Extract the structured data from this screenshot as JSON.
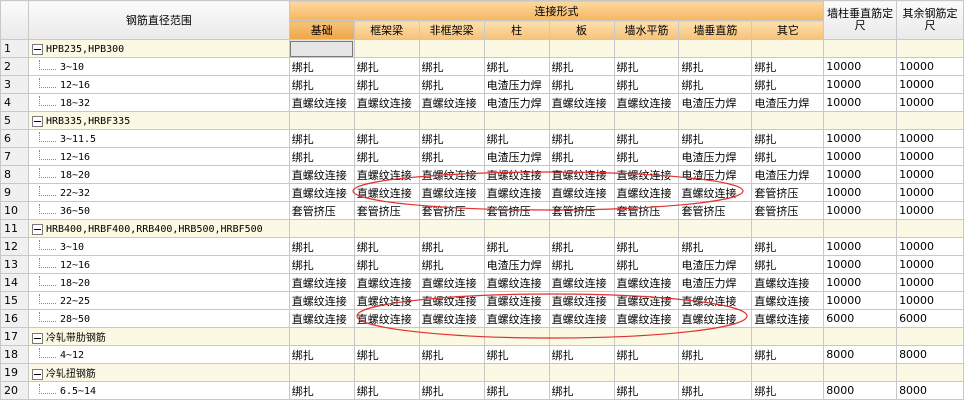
{
  "header": {
    "col_name": "钢筋直径范围",
    "group": "连接形式",
    "sub": [
      "基础",
      "框架梁",
      "非框架梁",
      "柱",
      "板",
      "墙水平筋",
      "墙垂直筋",
      "其它"
    ],
    "wall_col": "墙柱垂直筋定尺",
    "other_col": "其余钢筋定尺"
  },
  "rows": [
    {
      "n": "1",
      "group": true,
      "name": "HPB235,HPB300",
      "cells": [
        "",
        "",
        "",
        "",
        "",
        "",
        "",
        ""
      ],
      "a": "",
      "b": ""
    },
    {
      "n": "2",
      "name": "3~10",
      "cells": [
        "绑扎",
        "绑扎",
        "绑扎",
        "绑扎",
        "绑扎",
        "绑扎",
        "绑扎",
        "绑扎"
      ],
      "a": "10000",
      "b": "10000"
    },
    {
      "n": "3",
      "name": "12~16",
      "cells": [
        "绑扎",
        "绑扎",
        "绑扎",
        "电渣压力焊",
        "绑扎",
        "绑扎",
        "绑扎",
        "绑扎"
      ],
      "a": "10000",
      "b": "10000"
    },
    {
      "n": "4",
      "name": "18~32",
      "cells": [
        "直螺纹连接",
        "直螺纹连接",
        "直螺纹连接",
        "电渣压力焊",
        "直螺纹连接",
        "直螺纹连接",
        "电渣压力焊",
        "电渣压力焊"
      ],
      "a": "10000",
      "b": "10000"
    },
    {
      "n": "5",
      "group": true,
      "name": "HRB335,HRBF335",
      "cells": [
        "",
        "",
        "",
        "",
        "",
        "",
        "",
        ""
      ],
      "a": "",
      "b": ""
    },
    {
      "n": "6",
      "name": "3~11.5",
      "cells": [
        "绑扎",
        "绑扎",
        "绑扎",
        "绑扎",
        "绑扎",
        "绑扎",
        "绑扎",
        "绑扎"
      ],
      "a": "10000",
      "b": "10000"
    },
    {
      "n": "7",
      "name": "12~16",
      "cells": [
        "绑扎",
        "绑扎",
        "绑扎",
        "电渣压力焊",
        "绑扎",
        "绑扎",
        "电渣压力焊",
        "绑扎"
      ],
      "a": "10000",
      "b": "10000"
    },
    {
      "n": "8",
      "name": "18~20",
      "cells": [
        "直螺纹连接",
        "直螺纹连接",
        "直螺纹连接",
        "直螺纹连接",
        "直螺纹连接",
        "直螺纹连接",
        "电渣压力焊",
        "电渣压力焊"
      ],
      "a": "10000",
      "b": "10000"
    },
    {
      "n": "9",
      "name": "22~32",
      "cells": [
        "直螺纹连接",
        "直螺纹连接",
        "直螺纹连接",
        "直螺纹连接",
        "直螺纹连接",
        "直螺纹连接",
        "直螺纹连接",
        "套管挤压"
      ],
      "a": "10000",
      "b": "10000"
    },
    {
      "n": "10",
      "name": "36~50",
      "cells": [
        "套管挤压",
        "套管挤压",
        "套管挤压",
        "套管挤压",
        "套管挤压",
        "套管挤压",
        "套管挤压",
        "套管挤压"
      ],
      "a": "10000",
      "b": "10000"
    },
    {
      "n": "11",
      "group": true,
      "name": "HRB400,HRBF400,RRB400,HRB500,HRBF500",
      "cells": [
        "",
        "",
        "",
        "",
        "",
        "",
        "",
        ""
      ],
      "a": "",
      "b": ""
    },
    {
      "n": "12",
      "name": "3~10",
      "cells": [
        "绑扎",
        "绑扎",
        "绑扎",
        "绑扎",
        "绑扎",
        "绑扎",
        "绑扎",
        "绑扎"
      ],
      "a": "10000",
      "b": "10000"
    },
    {
      "n": "13",
      "name": "12~16",
      "cells": [
        "绑扎",
        "绑扎",
        "绑扎",
        "电渣压力焊",
        "绑扎",
        "绑扎",
        "电渣压力焊",
        "绑扎"
      ],
      "a": "10000",
      "b": "10000"
    },
    {
      "n": "14",
      "name": "18~20",
      "cells": [
        "直螺纹连接",
        "直螺纹连接",
        "直螺纹连接",
        "直螺纹连接",
        "直螺纹连接",
        "直螺纹连接",
        "电渣压力焊",
        "直螺纹连接"
      ],
      "a": "10000",
      "b": "10000"
    },
    {
      "n": "15",
      "name": "22~25",
      "cells": [
        "直螺纹连接",
        "直螺纹连接",
        "直螺纹连接",
        "直螺纹连接",
        "直螺纹连接",
        "直螺纹连接",
        "直螺纹连接",
        "直螺纹连接"
      ],
      "a": "10000",
      "b": "10000"
    },
    {
      "n": "16",
      "name": "28~50",
      "cells": [
        "直螺纹连接",
        "直螺纹连接",
        "直螺纹连接",
        "直螺纹连接",
        "直螺纹连接",
        "直螺纹连接",
        "直螺纹连接",
        "直螺纹连接"
      ],
      "a": "6000",
      "b": "6000"
    },
    {
      "n": "17",
      "group": true,
      "name": "冷轧带肋钢筋",
      "cells": [
        "",
        "",
        "",
        "",
        "",
        "",
        "",
        ""
      ],
      "a": "",
      "b": ""
    },
    {
      "n": "18",
      "name": "4~12",
      "cells": [
        "绑扎",
        "绑扎",
        "绑扎",
        "绑扎",
        "绑扎",
        "绑扎",
        "绑扎",
        "绑扎"
      ],
      "a": "8000",
      "b": "8000"
    },
    {
      "n": "19",
      "group": true,
      "name": "冷轧扭钢筋",
      "cells": [
        "",
        "",
        "",
        "",
        "",
        "",
        "",
        ""
      ],
      "a": "",
      "b": ""
    },
    {
      "n": "20",
      "name": "6.5~14",
      "cells": [
        "绑扎",
        "绑扎",
        "绑扎",
        "绑扎",
        "绑扎",
        "绑扎",
        "绑扎",
        "绑扎"
      ],
      "a": "8000",
      "b": "8000"
    }
  ],
  "colors": {
    "header_orange": "#f5b65e",
    "group_bg": "#fbf9e3",
    "annotation": "#e03030"
  }
}
